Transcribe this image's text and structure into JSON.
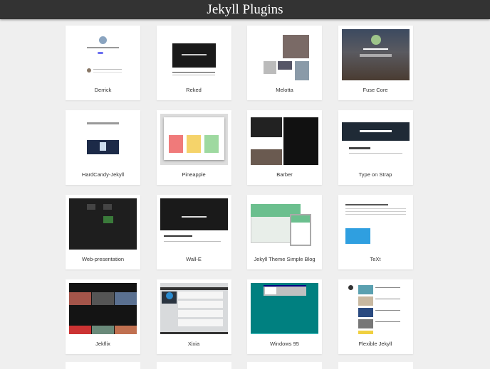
{
  "header": {
    "title": "Jekyll Plugins"
  },
  "themes": [
    {
      "name": "Derrick",
      "style": "derrick"
    },
    {
      "name": "Reked",
      "style": "reked"
    },
    {
      "name": "Melotta",
      "style": "melotta"
    },
    {
      "name": "Fuse Core",
      "style": "fuse"
    },
    {
      "name": "HardCandy-Jekyll",
      "style": "hardcandy"
    },
    {
      "name": "Pineapple",
      "style": "pineapple"
    },
    {
      "name": "Barber",
      "style": "barber"
    },
    {
      "name": "Type on Strap",
      "style": "strap"
    },
    {
      "name": "Web-presentation",
      "style": "webpres"
    },
    {
      "name": "Wall-E",
      "style": "walle"
    },
    {
      "name": "Jekyll Theme Simple Blog",
      "style": "simpleblog"
    },
    {
      "name": "TeXt",
      "style": "text"
    },
    {
      "name": "Jekflix",
      "style": "jekflix"
    },
    {
      "name": "Xixia",
      "style": "xixia"
    },
    {
      "name": "Windows 95",
      "style": "win95"
    },
    {
      "name": "Flexible Jekyll",
      "style": "flexible"
    }
  ]
}
